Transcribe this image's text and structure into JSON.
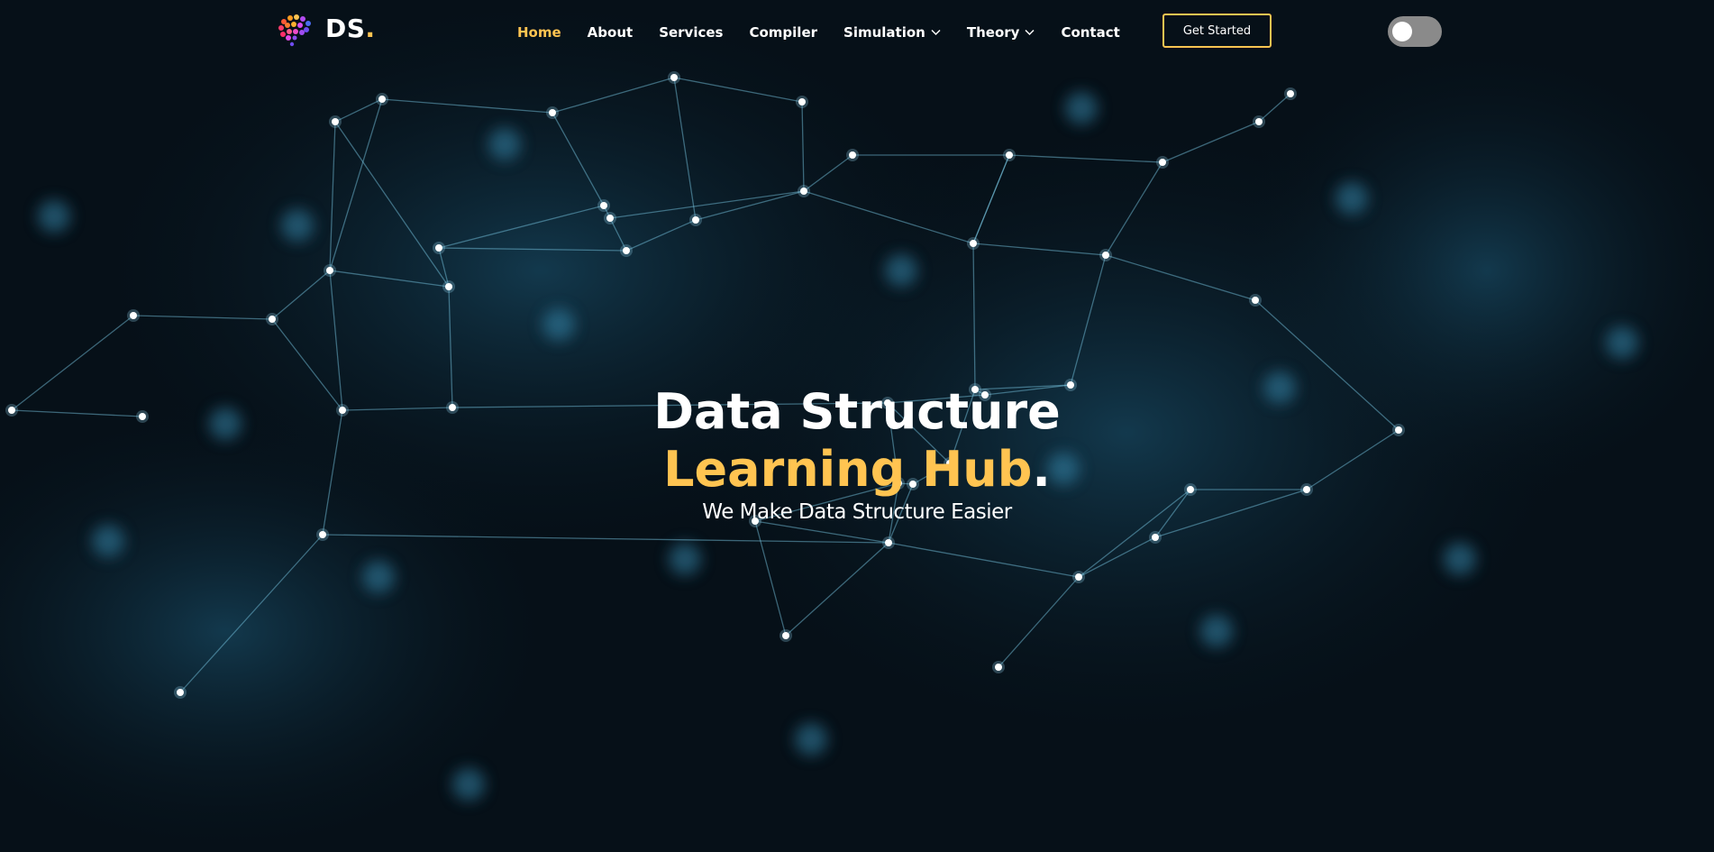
{
  "brand": {
    "name": "DS",
    "dot": ".",
    "accent_color": "#ffc451"
  },
  "nav": {
    "items": [
      {
        "label": "Home",
        "active": true,
        "dropdown": false
      },
      {
        "label": "About",
        "active": false,
        "dropdown": false
      },
      {
        "label": "Services",
        "active": false,
        "dropdown": false
      },
      {
        "label": "Compiler",
        "active": false,
        "dropdown": false
      },
      {
        "label": "Simulation",
        "active": false,
        "dropdown": true,
        "icon": "chevron-down-icon"
      },
      {
        "label": "Theory",
        "active": false,
        "dropdown": true,
        "icon": "chevron-down-icon"
      },
      {
        "label": "Contact",
        "active": false,
        "dropdown": false
      }
    ],
    "cta_label": "Get Started",
    "theme_toggle_on": false
  },
  "hero": {
    "title_line1": "Data Structure",
    "title_line2_accent": "Learning Hub",
    "title_line2_dot": ".",
    "subtitle": "We Make Data Structure Easier"
  },
  "theme": {
    "background": "#061018",
    "network_color": "#4fb3d9",
    "text": "#ffffff",
    "accent": "#ffc451"
  }
}
